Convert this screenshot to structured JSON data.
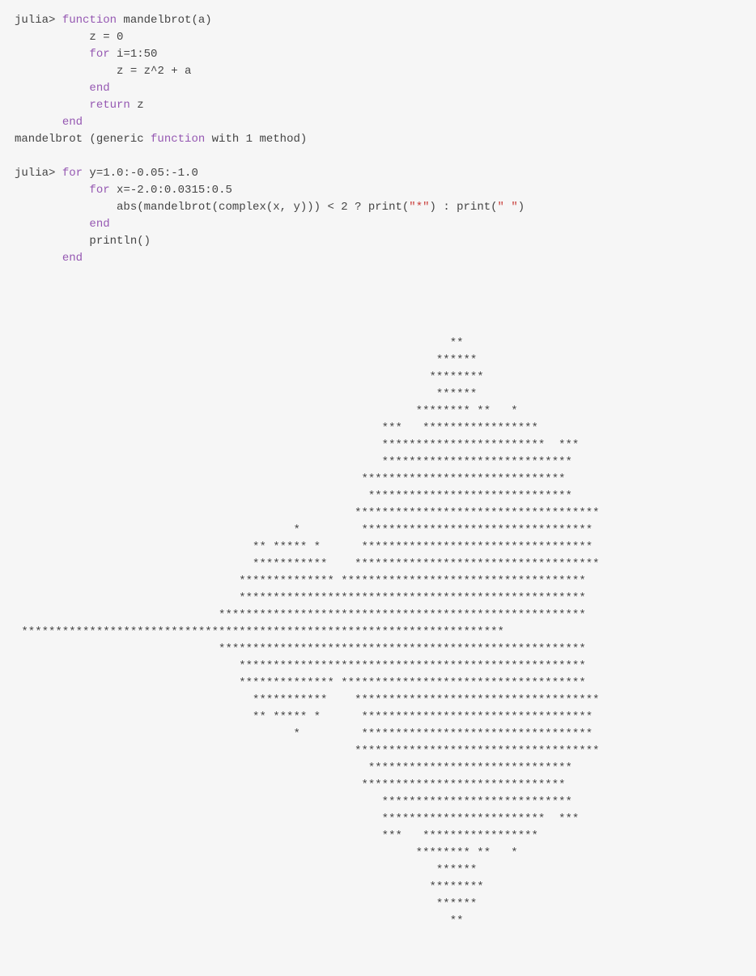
{
  "block1": {
    "line1": {
      "prompt": "julia> ",
      "kw1": "function",
      "rest": " mandelbrot(a)"
    },
    "line2": {
      "indent": "           ",
      "text": "z = 0"
    },
    "line3": {
      "indent": "           ",
      "kw": "for",
      "rest": " i=1:50"
    },
    "line4": {
      "indent": "               ",
      "text": "z = z^2 + a"
    },
    "line5": {
      "indent": "           ",
      "kw": "end"
    },
    "line6": {
      "indent": "           ",
      "kw": "return",
      "rest": " z"
    },
    "line7": {
      "indent": "       ",
      "kw": "end"
    },
    "line8": {
      "pre": "mandelbrot (generic ",
      "kw": "function",
      "post": " with 1 method)"
    }
  },
  "block2": {
    "line1": {
      "prompt": "julia> ",
      "kw": "for",
      "rest": " y=1.0:-0.05:-1.0"
    },
    "line2": {
      "indent": "           ",
      "kw": "for",
      "rest": " x=-2.0:0.0315:0.5"
    },
    "line3": {
      "indent": "               ",
      "pre": "abs(mandelbrot(complex(x, y))) < 2 ? print(",
      "str1": "\"*\"",
      "mid": ") : print(",
      "str2": "\" \"",
      "post": ")"
    },
    "line4": {
      "indent": "           ",
      "kw": "end"
    },
    "line5": {
      "indent": "           ",
      "text": "println()"
    },
    "line6": {
      "indent": "       ",
      "kw": "end"
    }
  },
  "output": [
    "                                                                                ",
    "                                                                                ",
    "                                                                                ",
    "                                                                **              ",
    "                                                              ******            ",
    "                                                             ********           ",
    "                                                              ******            ",
    "                                                           ******** **   *      ",
    "                                                      ***   *****************   ",
    "                                                      ************************  ***",
    "                                                      ****************************  ",
    "                                                   ******************************   ",
    "                                                    ******************************  ",
    "                                                  ************************************",
    "                                         *         **********************************",
    "                                   ** ***** *      **********************************",
    "                                   ***********    ************************************",
    "                                 ************** ************************************  ",
    "                                 ***************************************************  ",
    "                              ******************************************************  ",
    " ***********************************************************************              ",
    "                              ******************************************************  ",
    "                                 ***************************************************  ",
    "                                 ************** ************************************  ",
    "                                   ***********    ************************************",
    "                                   ** ***** *      **********************************",
    "                                         *         **********************************",
    "                                                  ************************************",
    "                                                    ******************************  ",
    "                                                   ******************************   ",
    "                                                      ****************************  ",
    "                                                      ************************  ***",
    "                                                      ***   *****************   ",
    "                                                           ******** **   *      ",
    "                                                              ******            ",
    "                                                             ********           ",
    "                                                              ******            ",
    "                                                                **              ",
    "                                                                                ",
    "                                                                                "
  ]
}
